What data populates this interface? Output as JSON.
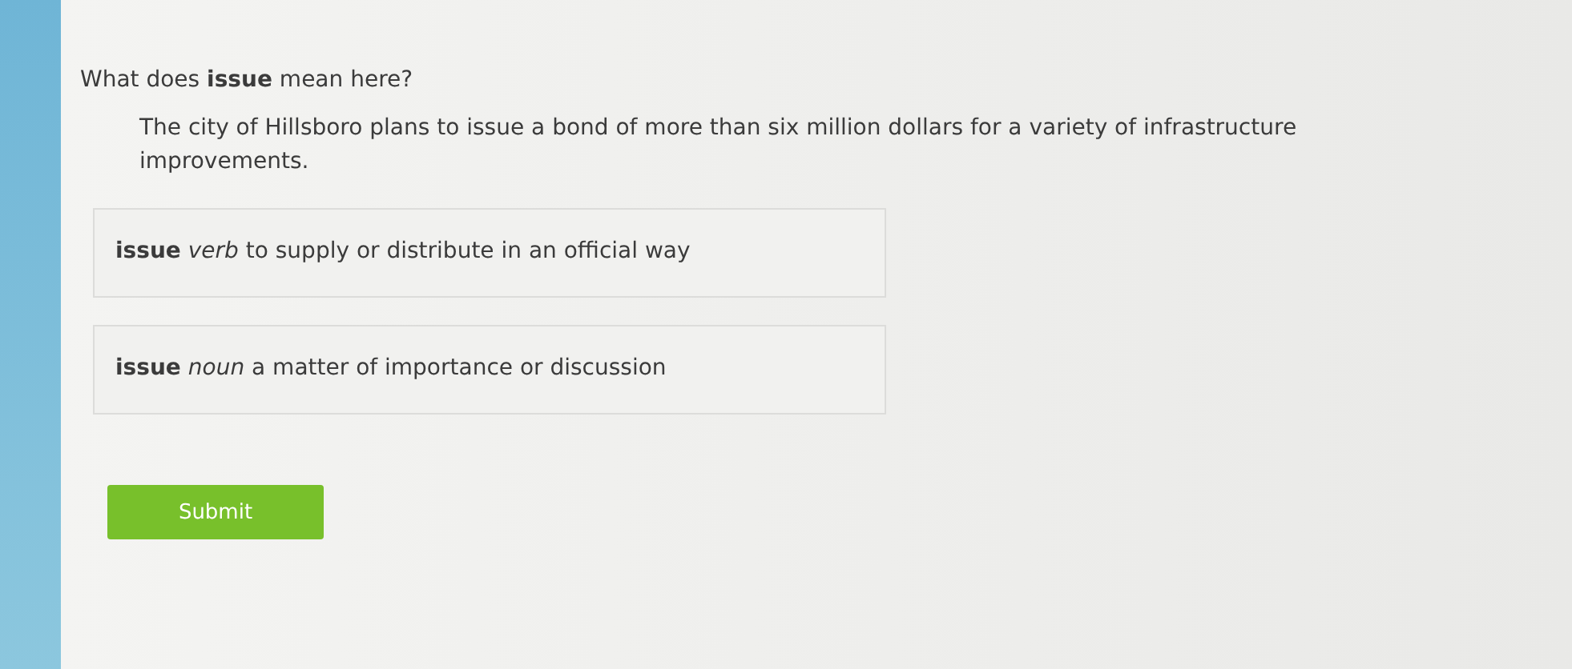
{
  "question": "What does **issue** mean here?",
  "passage": "The city of Hillsboro plans to issue a bond of more than six million dollars for a variety of infrastructure improvements.",
  "options": [
    {
      "text": "**issue** *verb* to supply or distribute in an official way",
      "selected": false
    },
    {
      "text": "**issue** *noun* a matter of importance or discussion",
      "selected": false
    }
  ],
  "submit": "Submit"
}
